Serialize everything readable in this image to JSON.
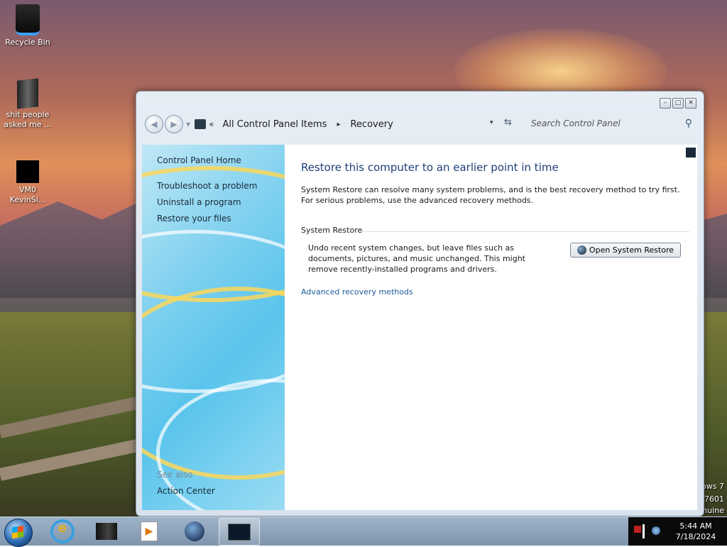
{
  "desktop": {
    "icons": [
      {
        "label_line1": "Recycle Bin",
        "label_line2": ""
      },
      {
        "label_line1": "shit people",
        "label_line2": "asked me ..."
      },
      {
        "label_line1": "VM0",
        "label_line2": "KevinSi..."
      }
    ],
    "watermark": {
      "line1": "ows 7",
      "line2": "7601",
      "line3": "nuine"
    }
  },
  "window": {
    "controls": {
      "minimize": "–",
      "maximize": "□",
      "close": "✕"
    },
    "address": {
      "chevron": "«",
      "breadcrumb": [
        "All Control Panel Items",
        "Recovery"
      ],
      "separator": "▸",
      "dropdown_glyph": "▾",
      "refresh_glyph": "⇆"
    },
    "search": {
      "placeholder": "Search Control Panel",
      "icon": "search-icon"
    },
    "left_pane": {
      "home": "Control Panel Home",
      "tasks": [
        "Troubleshoot a problem",
        "Uninstall a program",
        "Restore your files"
      ],
      "see_also_label": "See also",
      "see_also": [
        "Action Center"
      ]
    },
    "content": {
      "title": "Restore this computer to an earlier point in time",
      "description": "System Restore can resolve many system problems, and is the best recovery method to try first. For serious problems, use the advanced recovery methods.",
      "section_title": "System Restore",
      "section_text": "Undo recent system changes, but leave files such as documents, pictures, and music unchanged. This might remove recently-installed programs and drivers.",
      "button_label": "Open System Restore",
      "advanced_link": "Advanced recovery methods"
    }
  },
  "taskbar": {
    "pinned": [
      "internet-explorer-icon",
      "folder-icon",
      "media-player-icon",
      "globe-icon",
      "control-panel-icon"
    ],
    "active_index": 4,
    "clock": {
      "time": "5:44 AM",
      "date": "7/18/2024"
    }
  }
}
